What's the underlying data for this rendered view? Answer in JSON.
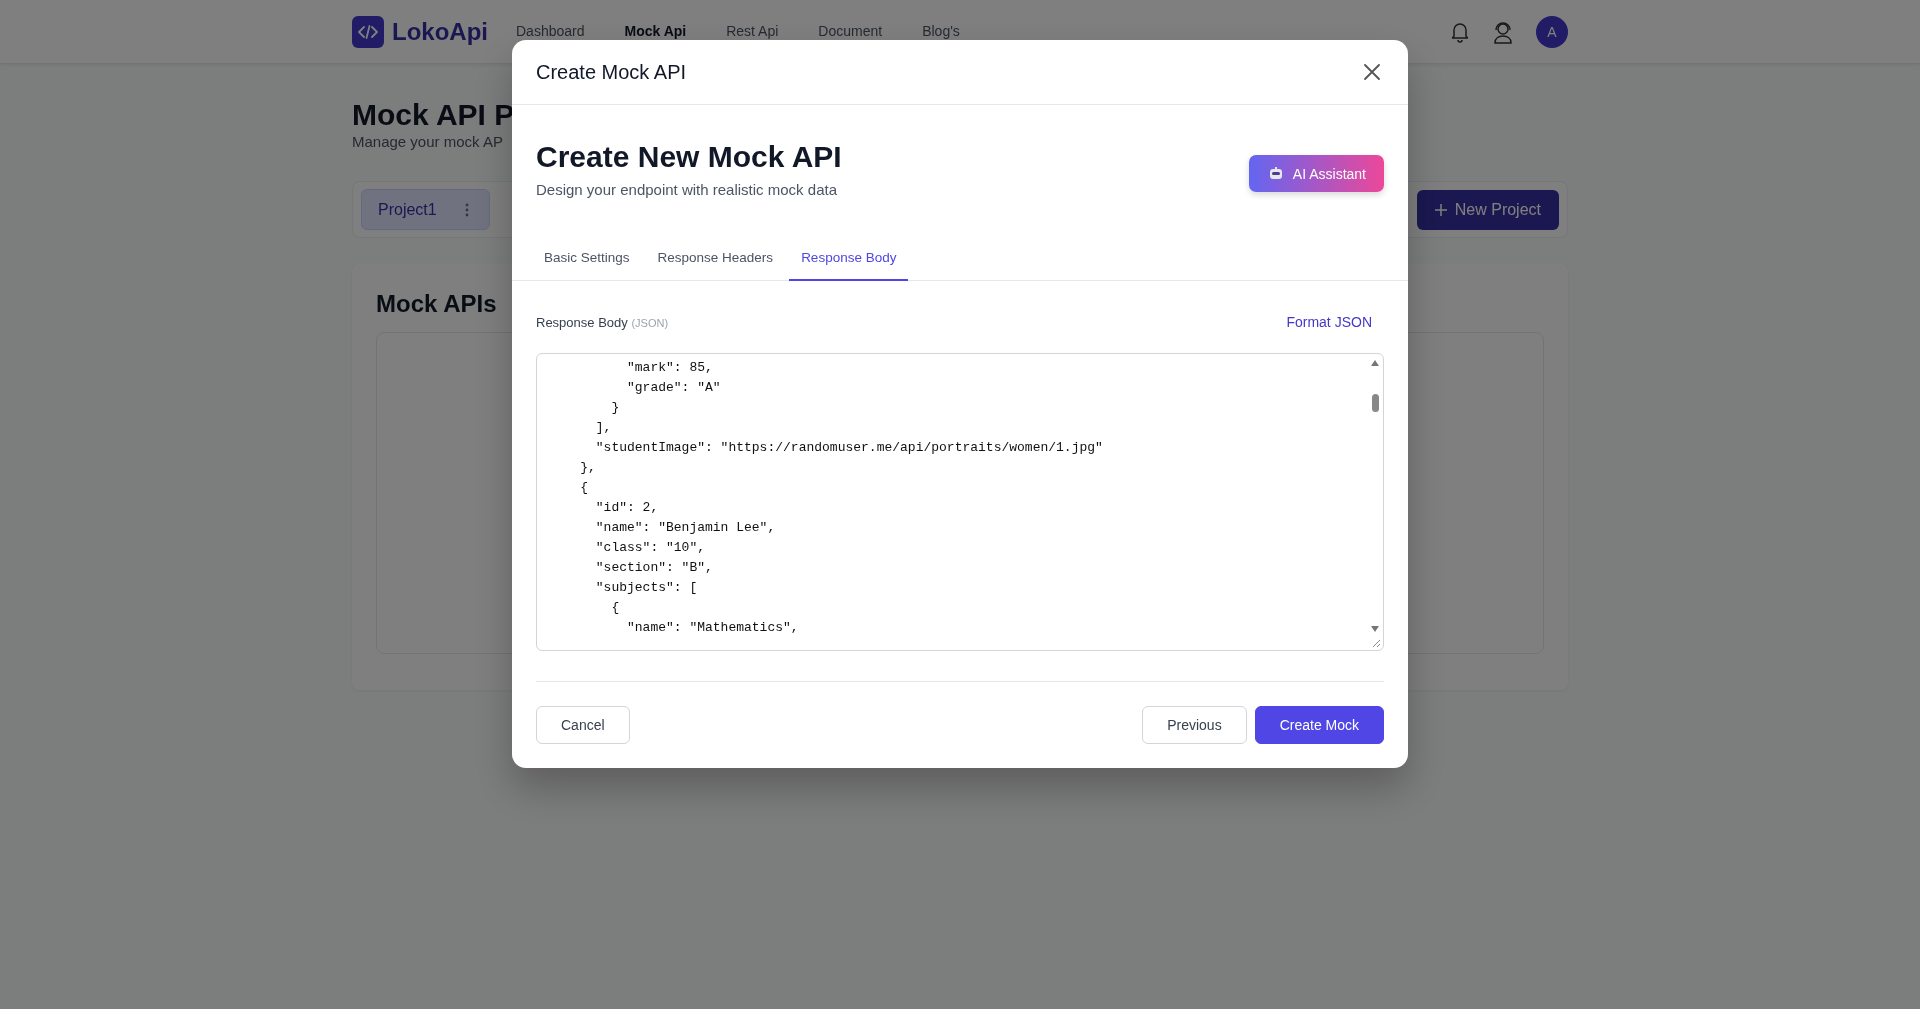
{
  "navbar": {
    "logo": "LokoApi",
    "links": [
      {
        "label": "Dashboard",
        "selected": false
      },
      {
        "label": "Mock Api",
        "selected": true
      },
      {
        "label": "Rest Api",
        "selected": false
      },
      {
        "label": "Document",
        "selected": false
      },
      {
        "label": "Blog's",
        "selected": false
      }
    ],
    "avatar": "A"
  },
  "page": {
    "title": "Mock API P",
    "subtitle": "Manage your mock AP",
    "projects": [
      {
        "label": "Project1",
        "selected": true
      }
    ],
    "new_project": "New Project",
    "section_title": "Mock APIs"
  },
  "modal": {
    "title": "Create Mock API",
    "heading": "Create New Mock API",
    "subheading": "Design your endpoint with realistic mock data",
    "ai_button": "AI Assistant",
    "tabs": [
      {
        "label": "Basic Settings",
        "selected": false
      },
      {
        "label": "Response Headers",
        "selected": false
      },
      {
        "label": "Response Body",
        "selected": true
      }
    ],
    "body_label": "Response Body",
    "body_hint": "(JSON)",
    "format_button": "Format JSON",
    "code_lines": [
      "          \"mark\": 85,",
      "          \"grade\": \"A\"",
      "        }",
      "      ],",
      "      \"studentImage\": \"https://randomuser.me/api/portraits/women/1.jpg\"",
      "    },",
      "    {",
      "      \"id\": 2,",
      "      \"name\": \"Benjamin Lee\",",
      "      \"class\": \"10\",",
      "      \"section\": \"B\",",
      "      \"subjects\": [",
      "        {",
      "          \"name\": \"Mathematics\","
    ],
    "cancel": "Cancel",
    "previous": "Previous",
    "create": "Create Mock"
  }
}
